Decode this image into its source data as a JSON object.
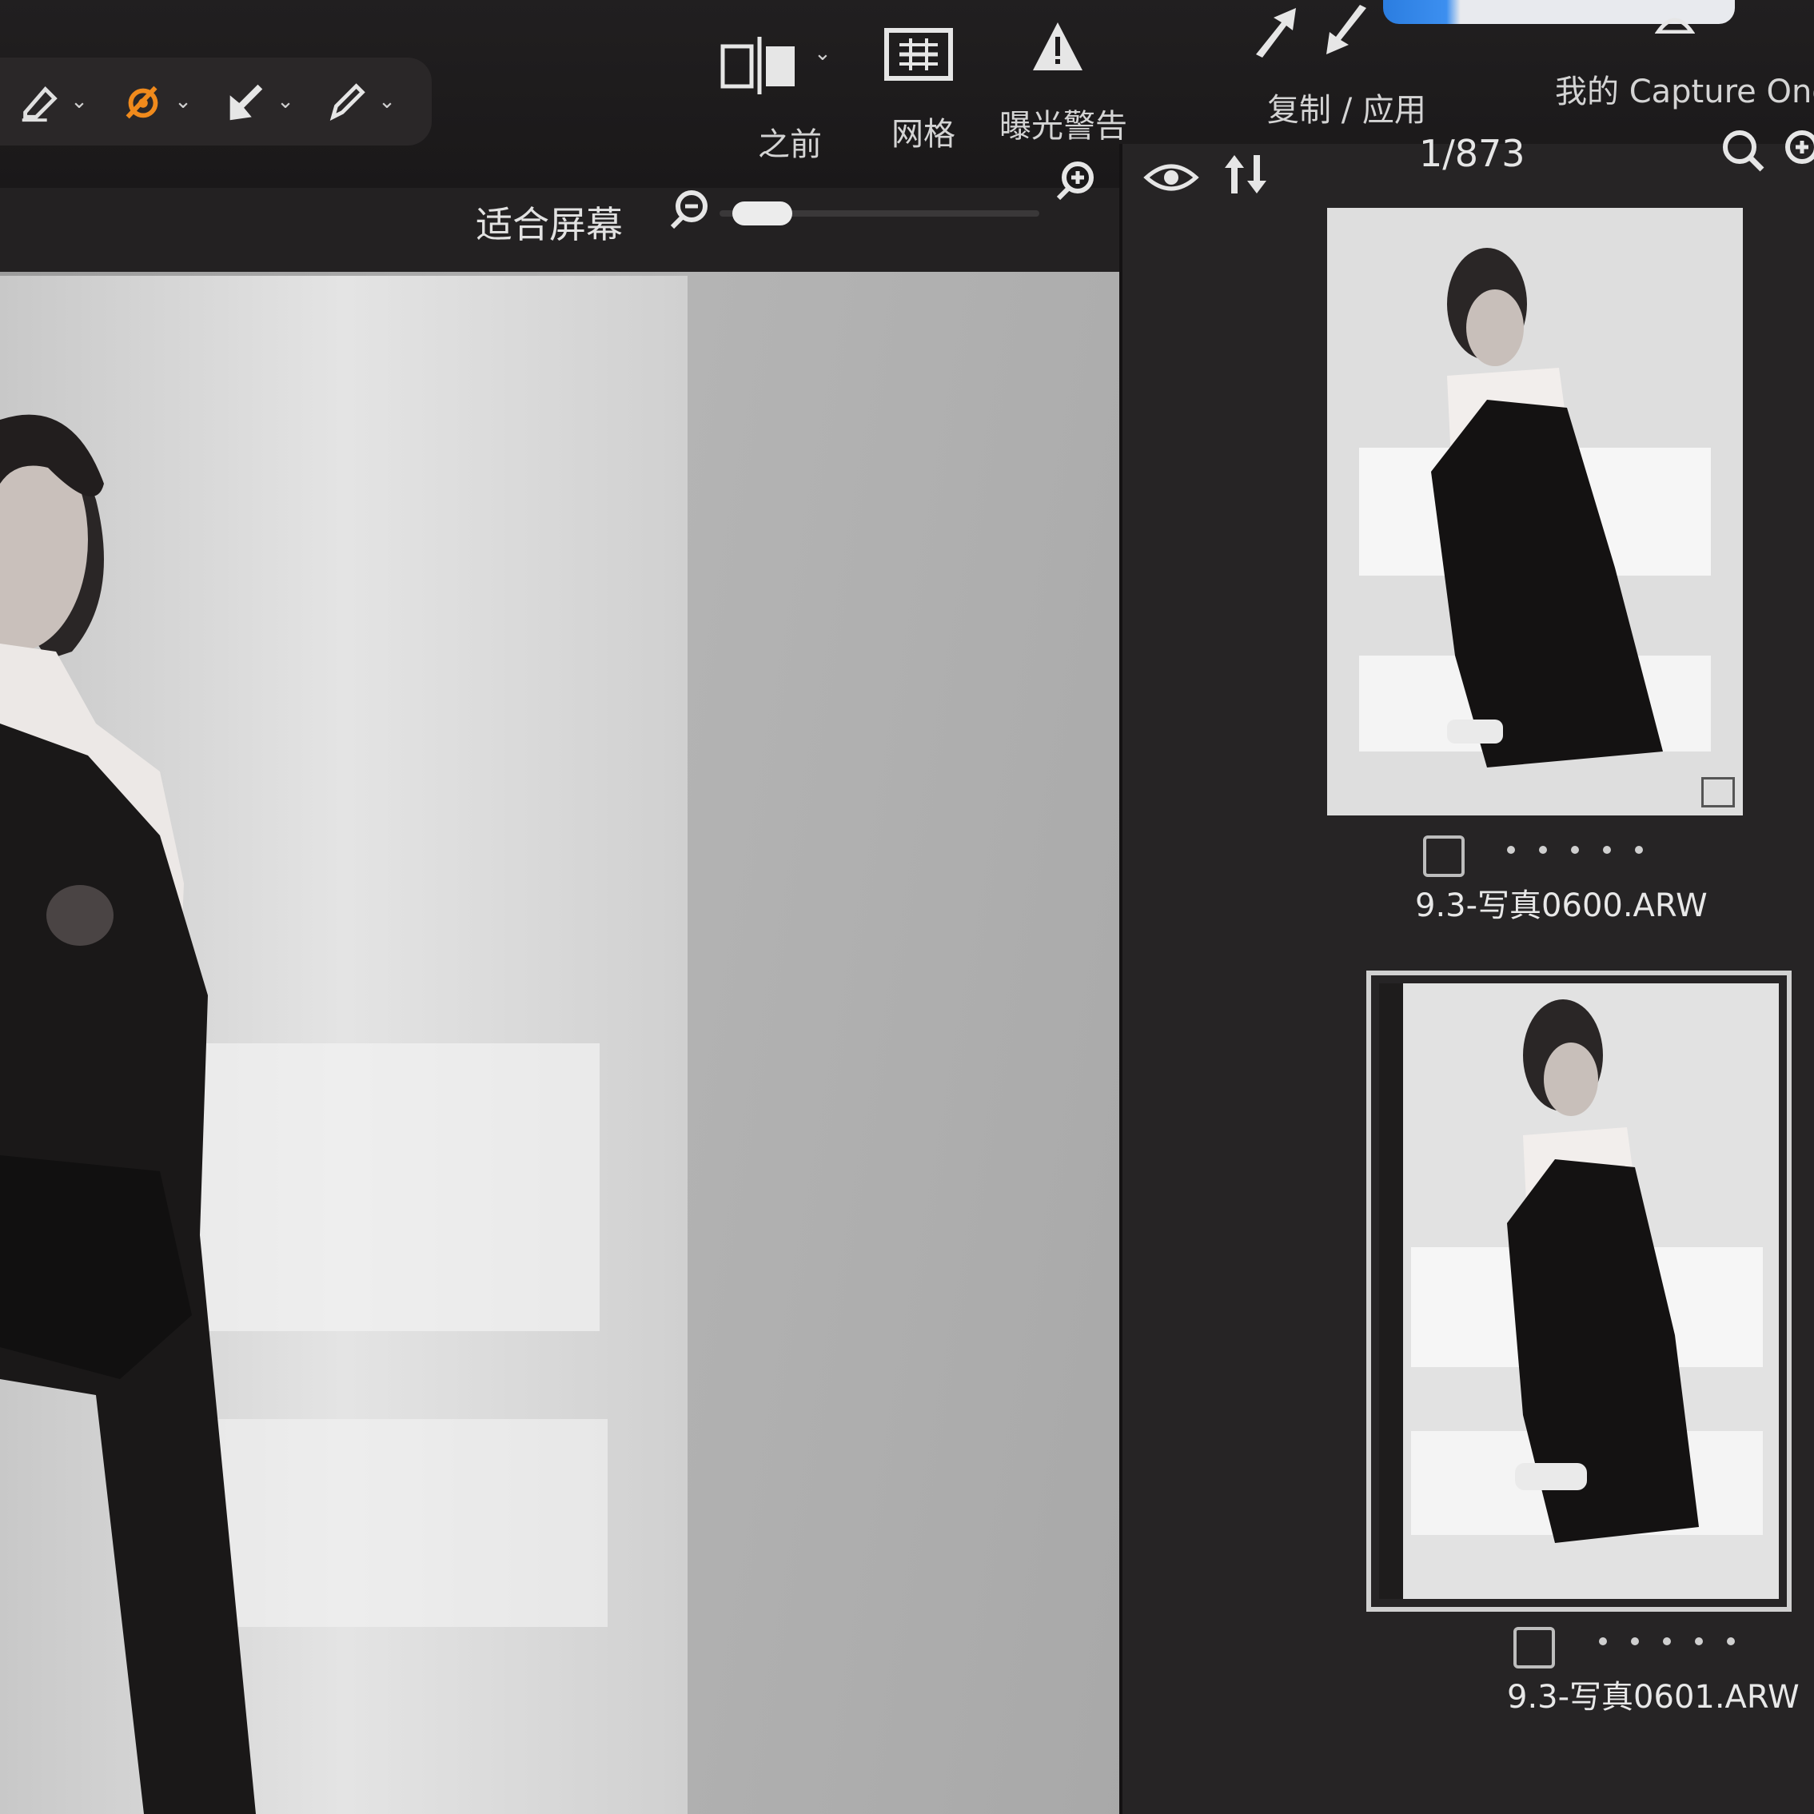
{
  "toolbar": {
    "tools": [
      {
        "name": "eraser-tool",
        "icon": "eraser-icon"
      },
      {
        "name": "mask-brush-tool",
        "icon": "orange-brush-icon",
        "color": "#f08a1c"
      },
      {
        "name": "pick-tool",
        "icon": "arrow-cursor-icon"
      },
      {
        "name": "annotate-tool",
        "icon": "pen-icon"
      }
    ],
    "before_label": "之前",
    "grid_label": "网格",
    "exposure_warning_label": "曝光警告",
    "copy_apply_label": "复制 / 应用",
    "my_capture_one_label": "我的 Capture One"
  },
  "viewer": {
    "zoom_label": "适合屏幕",
    "zoom_level": 0.05
  },
  "browser": {
    "counter": "1/873",
    "thumbnails": [
      {
        "filename": "9.3-写真0600.ARW",
        "selected": false
      },
      {
        "filename": "9.3-写真0601.ARW",
        "selected": true
      }
    ]
  },
  "colors": {
    "accent_orange": "#f08a1c",
    "panel_dark": "#1c1a1b",
    "popup_blue": "#2b7de0"
  }
}
